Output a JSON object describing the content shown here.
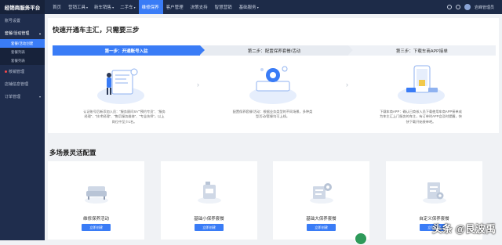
{
  "header": {
    "brand": "经销商服务平台",
    "nav": [
      {
        "label": "首页",
        "caret": ""
      },
      {
        "label": "营销工具",
        "caret": "▾"
      },
      {
        "label": "新车销售",
        "caret": "▾"
      },
      {
        "label": "二手车",
        "caret": "▾"
      },
      {
        "label": "维修保养",
        "caret": "",
        "active": true
      },
      {
        "label": "客户管理",
        "caret": ""
      },
      {
        "label": "决策支持",
        "caret": ""
      },
      {
        "label": "智慧营销",
        "caret": ""
      },
      {
        "label": "基础服务",
        "caret": "▾"
      }
    ],
    "user": "岩峰管理员"
  },
  "sidebar": {
    "items": [
      {
        "label": "账号设置",
        "type": "item"
      },
      {
        "label": "套餐/活动管理",
        "type": "open",
        "arrow": "▴"
      },
      {
        "label": "套餐/活动创建",
        "type": "sub",
        "active": true
      },
      {
        "label": "套餐列表",
        "type": "sub"
      },
      {
        "label": "套餐列表",
        "type": "sub"
      },
      {
        "label": "核销管理",
        "type": "item",
        "dot": true
      },
      {
        "label": "店铺信息管理",
        "type": "item"
      },
      {
        "label": "订单管理",
        "type": "item",
        "arrow": "▾"
      }
    ]
  },
  "steps": {
    "title": "快速开通车主汇，只需要三步",
    "items": [
      {
        "label": "第一步：开通账号入驻",
        "desc": "认证账号后新添加入员：“服务顾问SA”“预约专员”、“服务经理”、“技术经理”、“售后服务维修”、“专业技师”，以上岗位中至少1名。"
      },
      {
        "label": "第二步：配置保养套餐/活动",
        "desc": "配置保养套餐/活动：根据业务类型的不同场景，多种类型活动/套餐均可上线。"
      },
      {
        "label": "第三步：下载车商APP接单",
        "desc": "下载车商APP：确认已商核入员下载使用车商APP接单成为车主汇上门服务的车主，有订单时APP会及时提醒，快快下载开始接单吧。"
      }
    ]
  },
  "packages": {
    "title": "多场景灵活配置",
    "items": [
      {
        "label": "维修保养活动",
        "button": "立即创建"
      },
      {
        "label": "基础小保养套餐",
        "button": "立即创建"
      },
      {
        "label": "基础大保养套餐",
        "button": "立即创建"
      },
      {
        "label": "自定义保养套餐",
        "button": "立即创建"
      }
    ]
  },
  "watermark": "头条 @艮波禹",
  "colors": {
    "accent": "#3a7cf6",
    "topbar": "#1d2b48",
    "sidebar": "#1f2d4d"
  }
}
